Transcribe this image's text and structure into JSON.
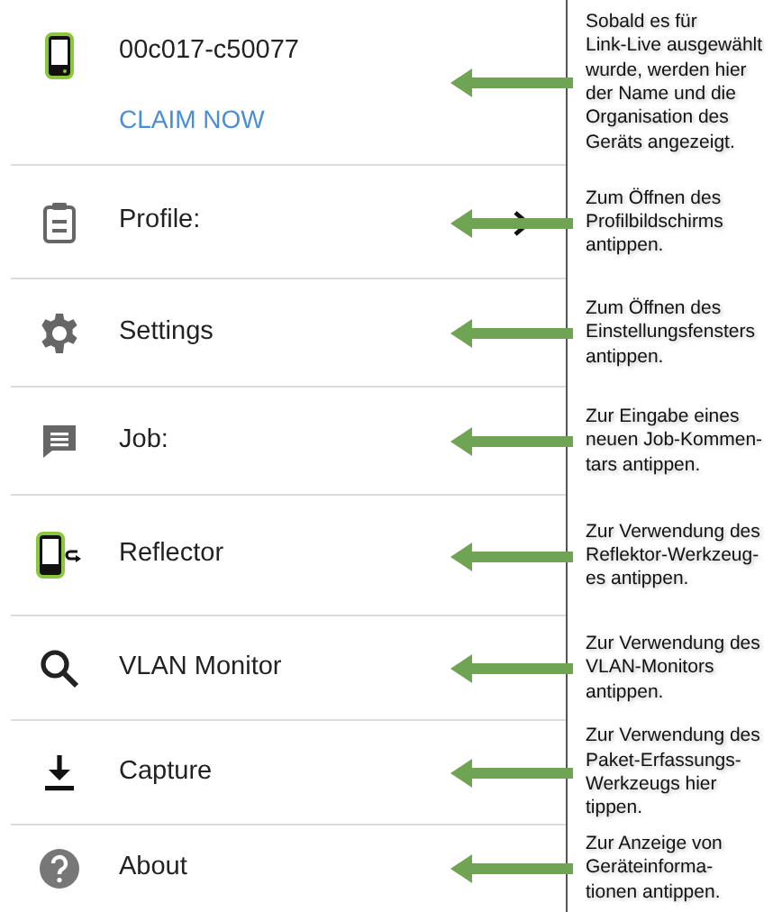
{
  "device": {
    "name": "00c017-c50077",
    "link": "CLAIM NOW",
    "note": "Sobald es für\nLink-Live ausgewählt\nwurde, werden hier\nder Name und die\nOrganisation des\nGeräts angezeigt."
  },
  "menu": [
    {
      "label": "Profile:",
      "chevron": true,
      "note": "Zum Öffnen des\nProfilbildschirms\nantippen."
    },
    {
      "label": "Settings",
      "chevron": false,
      "note": "Zum Öffnen des\nEinstellungsfensters\nantippen."
    },
    {
      "label": "Job:",
      "chevron": false,
      "note": "Zur Eingabe eines\nneuen Job-Kommen-\ntars antippen."
    },
    {
      "label": "Reflector",
      "chevron": false,
      "note": "Zur Verwendung des\nReflektor-Werkzeug-\nes antippen."
    },
    {
      "label": "VLAN Monitor",
      "chevron": false,
      "note": "Zur Verwendung des\nVLAN-Monitors\nantippen."
    },
    {
      "label": "Capture",
      "chevron": false,
      "note": "Zur Verwendung des\nPaket-Erfassungs-\nWerkzeugs hier\ntippen."
    },
    {
      "label": "About",
      "chevron": false,
      "note": "Zur Anzeige von\nGeräteinforma-\ntionen antippen."
    }
  ]
}
